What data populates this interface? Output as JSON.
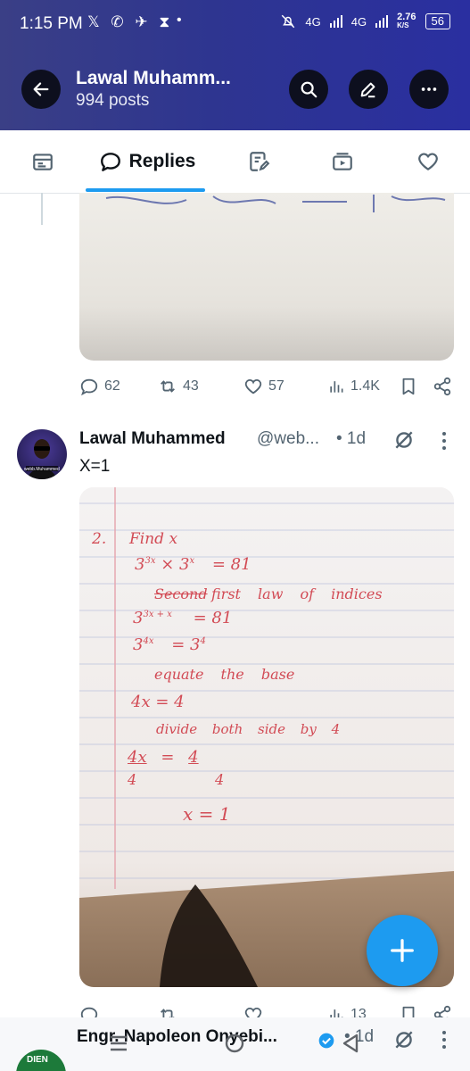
{
  "status_bar": {
    "time": "1:15 PM",
    "app_icons": "𝕏 ✆ ✈ ⧗",
    "dot": "•",
    "network1": "4G",
    "network2": "4G",
    "speed": "2.76",
    "speed_unit": "K/S",
    "battery": "56"
  },
  "header": {
    "title": "Lawal Muhamm...",
    "subtitle": "994 posts"
  },
  "tabs": [
    {
      "label": "",
      "icon": "article-icon"
    },
    {
      "label": "Replies",
      "icon": "reply-bubble-icon",
      "active": true
    },
    {
      "label": "",
      "icon": "highlights-icon"
    },
    {
      "label": "",
      "icon": "media-icon"
    },
    {
      "label": "",
      "icon": "likes-icon"
    }
  ],
  "post1_actions": {
    "replies": "62",
    "reposts": "43",
    "likes": "57",
    "views": "1.4K"
  },
  "tweet": {
    "name": "Lawal Muhammed",
    "handle": "@web...",
    "time": "• 1d",
    "text": "X=1",
    "avatar_label": "webb.Muhammed",
    "handwriting": {
      "q_number": "2.",
      "line1": "Find x",
      "line2_a": "3",
      "line2_exp1": "3x",
      "line2_b": "× 3",
      "line2_exp2": "x",
      "line2_c": "= 81",
      "line3_struck": "Second",
      "line3": "first law of indices",
      "line4_a": "3",
      "line4_exp": "3x + x",
      "line4_b": "= 81",
      "line5_a": "3",
      "line5_exp": "4x",
      "line5_b": "= 3",
      "line5_exp2": "4",
      "line6": "equate the base",
      "line7": "4x = 4",
      "line8": "divide both side by 4",
      "line9_a": "4x",
      "line9_b": "=",
      "line9_c": "4",
      "line9_den": "4",
      "line10": "x = 1"
    }
  },
  "post2_actions": {
    "views": "13"
  },
  "next_tweet": {
    "name": "Engr. Napoleon Onyebi...",
    "time": "• 1d",
    "avatar_label": "DIEN"
  },
  "colors": {
    "accent": "#1d9bf0",
    "header_bg": "#2e3590",
    "ink": "#d24b55"
  }
}
